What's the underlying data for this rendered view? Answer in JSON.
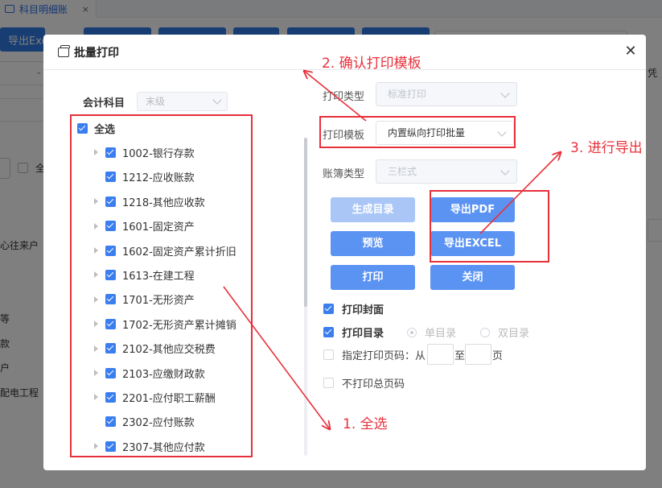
{
  "background": {
    "tab": {
      "label": "科目明细账",
      "close": "×"
    },
    "toolbar_first_btn": "导出Excel",
    "left_labels": [
      "心往来户",
      "等",
      "款",
      "户",
      "配电工程",
      "全"
    ],
    "right_text": "凭"
  },
  "modal": {
    "title": "批量打印",
    "close_icon": "close-icon",
    "subject": {
      "label": "会计科目",
      "value": "末级"
    },
    "tree": {
      "select_all": "全选",
      "items": [
        {
          "code": "1002-银行存款",
          "expandable": true
        },
        {
          "code": "1212-应收账款",
          "expandable": false
        },
        {
          "code": "1218-其他应收款",
          "expandable": true
        },
        {
          "code": "1601-固定资产",
          "expandable": true
        },
        {
          "code": "1602-固定资产累计折旧",
          "expandable": true
        },
        {
          "code": "1613-在建工程",
          "expandable": true
        },
        {
          "code": "1701-无形资产",
          "expandable": true
        },
        {
          "code": "1702-无形资产累计摊销",
          "expandable": true
        },
        {
          "code": "2102-其他应交税费",
          "expandable": true
        },
        {
          "code": "2103-应缴财政款",
          "expandable": true
        },
        {
          "code": "2201-应付职工薪酬",
          "expandable": true
        },
        {
          "code": "2302-应付账款",
          "expandable": false
        },
        {
          "code": "2307-其他应付款",
          "expandable": true
        }
      ]
    },
    "form": {
      "print_type_label": "打印类型",
      "print_type_value": "标准打印",
      "template_label": "打印模板",
      "template_value": "内置纵向打印批量",
      "book_type_label": "账簿类型",
      "book_type_value": "三栏式"
    },
    "buttons": {
      "gen_toc": "生成目录",
      "export_pdf": "导出PDF",
      "preview": "预览",
      "export_excel": "导出EXCEL",
      "print": "打印",
      "close": "关闭"
    },
    "options": {
      "print_cover": "打印封面",
      "print_toc": "打印目录",
      "single_toc": "单目录",
      "double_toc": "双目录",
      "page_range_label": "指定打印页码：从",
      "page_to": "至",
      "page_unit": "页",
      "no_total_pages": "不打印总页码"
    }
  },
  "annotations": {
    "step1": "1. 全选",
    "step2": "2. 确认打印模板",
    "step3": "3. 进行导出",
    "color": "#e8303a"
  }
}
